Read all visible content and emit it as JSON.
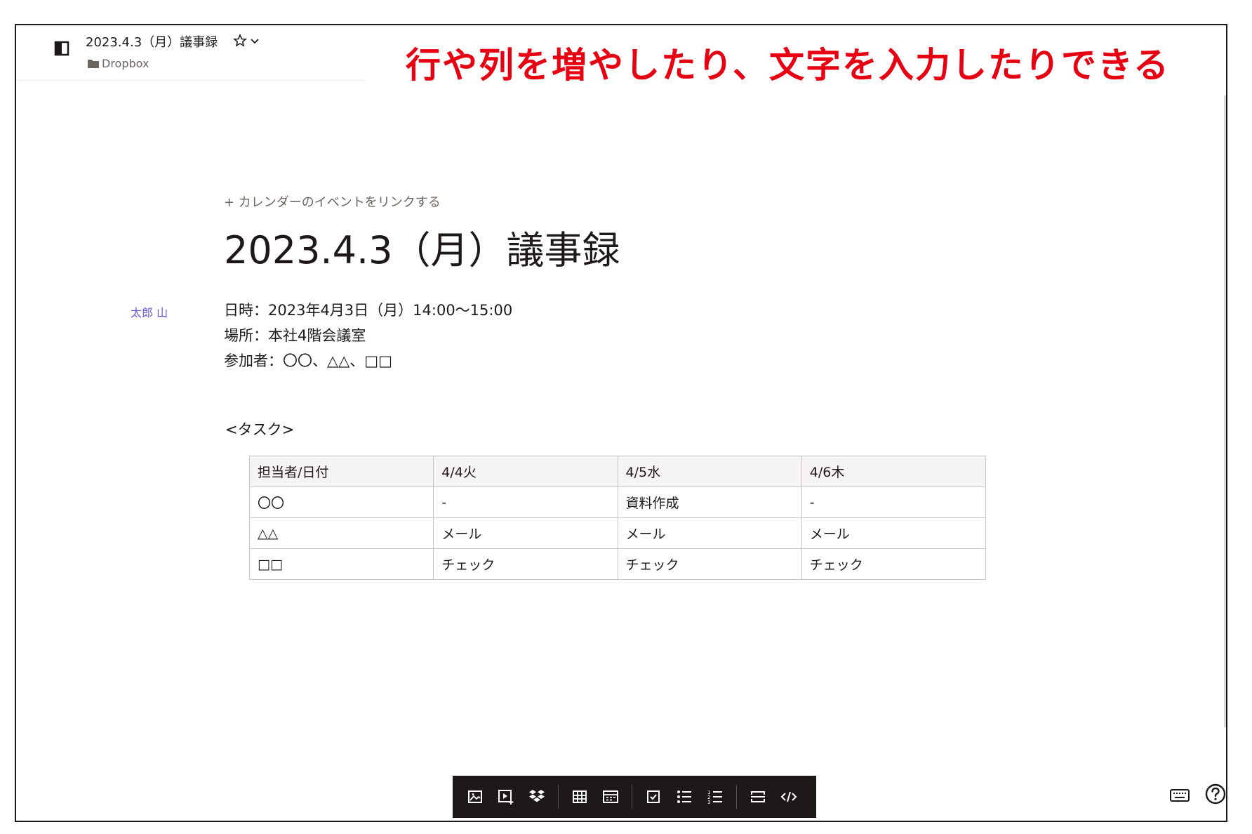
{
  "header": {
    "doc_title": "2023.4.3（月）議事録",
    "folder": "Dropbox"
  },
  "annotation": "行や列を増やしたり、文字を入力したりできる",
  "doc": {
    "link_calendar": "+ カレンダーのイベントをリンクする",
    "title": "2023.4.3（月）議事録",
    "author": "太郎 山",
    "meta_lines": [
      "日時：2023年4月3日（月）14:00～15:00",
      "場所：本社4階会議室",
      "参加者：〇〇、△△、□□"
    ],
    "task_heading": "<タスク>",
    "table": {
      "headers": [
        "担当者/日付",
        "4/4火",
        "4/5水",
        "4/6木"
      ],
      "rows": [
        [
          "〇〇",
          "-",
          "資料作成",
          "-"
        ],
        [
          "△△",
          "メール",
          "メール",
          "メール"
        ],
        [
          "□□",
          "チェック",
          "チェック",
          "チェック"
        ]
      ]
    }
  },
  "toolbar": {
    "buttons": [
      "image-icon",
      "video-icon",
      "dropbox-icon",
      "table-icon",
      "timeline-icon",
      "checklist-icon",
      "bullet-list-icon",
      "numbered-list-icon",
      "divider-icon",
      "code-icon"
    ]
  },
  "colors": {
    "annotation": "#e60012",
    "author": "#6a5ad8",
    "toolbar_bg": "#1e1919"
  }
}
